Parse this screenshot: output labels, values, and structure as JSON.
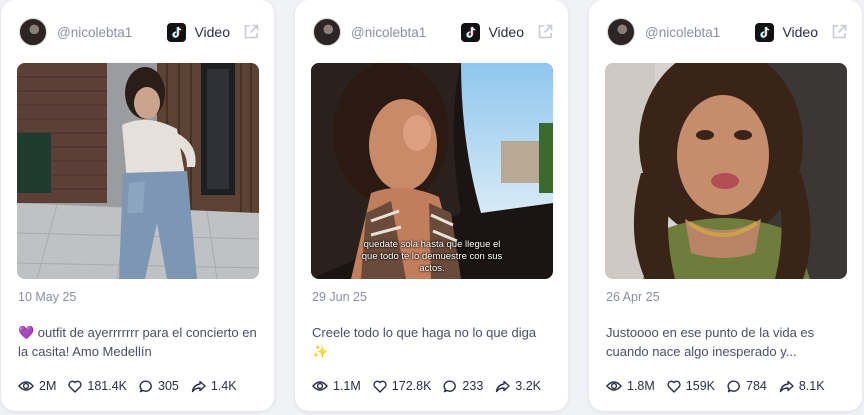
{
  "cards": [
    {
      "handle": "@nicolebta1",
      "platform": "Video",
      "date": "10 May 25",
      "description": "💜 outfit de ayerrrrrrr para el concierto en la casita! Amo Medellín",
      "stats": {
        "views": "2M",
        "likes": "181.4K",
        "comments": "305",
        "shares": "1.4K"
      }
    },
    {
      "handle": "@nicolebta1",
      "platform": "Video",
      "date": "29 Jun 25",
      "description": "Creele todo lo que haga no lo que diga ✨",
      "overlay_text": "quedate sola hasta que llegue el que todo te lo demuestre con sus actos.",
      "stats": {
        "views": "1.1M",
        "likes": "172.8K",
        "comments": "233",
        "shares": "3.2K"
      }
    },
    {
      "handle": "@nicolebta1",
      "platform": "Video",
      "date": "26 Apr 25",
      "description": "Justoooo en ese punto de la vida es cuando nace algo inesperado y...",
      "stats": {
        "views": "1.8M",
        "likes": "159K",
        "comments": "784",
        "shares": "8.1K"
      }
    }
  ],
  "icons": [
    "avatar",
    "tiktok-icon",
    "external-link-icon",
    "eye-icon",
    "heart-icon",
    "comment-icon",
    "share-icon"
  ]
}
